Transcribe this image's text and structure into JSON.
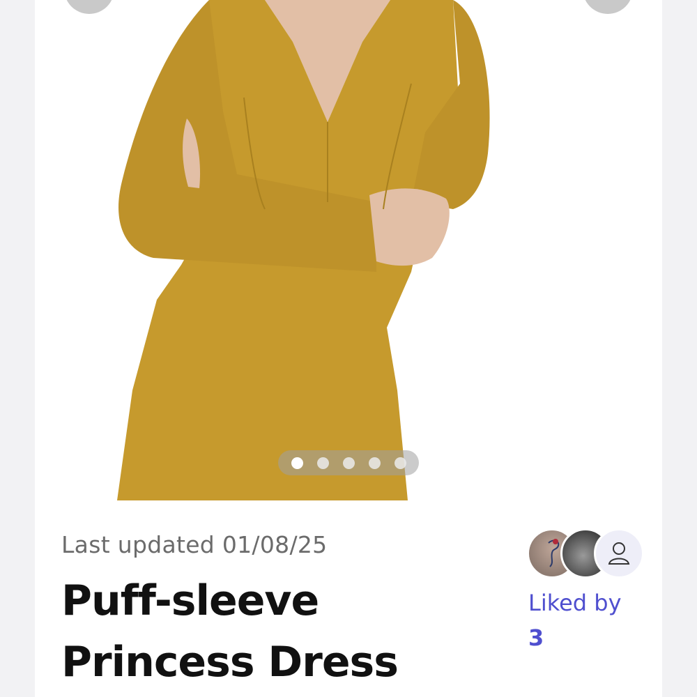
{
  "product": {
    "last_updated": "Last updated 01/08/25",
    "title": "Puff-sleeve Princess Dress",
    "dress_color": "#C69A2D"
  },
  "carousel": {
    "image_count": 5,
    "active_index": 0
  },
  "likes": {
    "label": "Liked by",
    "count": "3",
    "accent_color": "#4F4FCF",
    "avatars": [
      "user-avatar",
      "user-avatar",
      "generic-user-icon"
    ]
  }
}
